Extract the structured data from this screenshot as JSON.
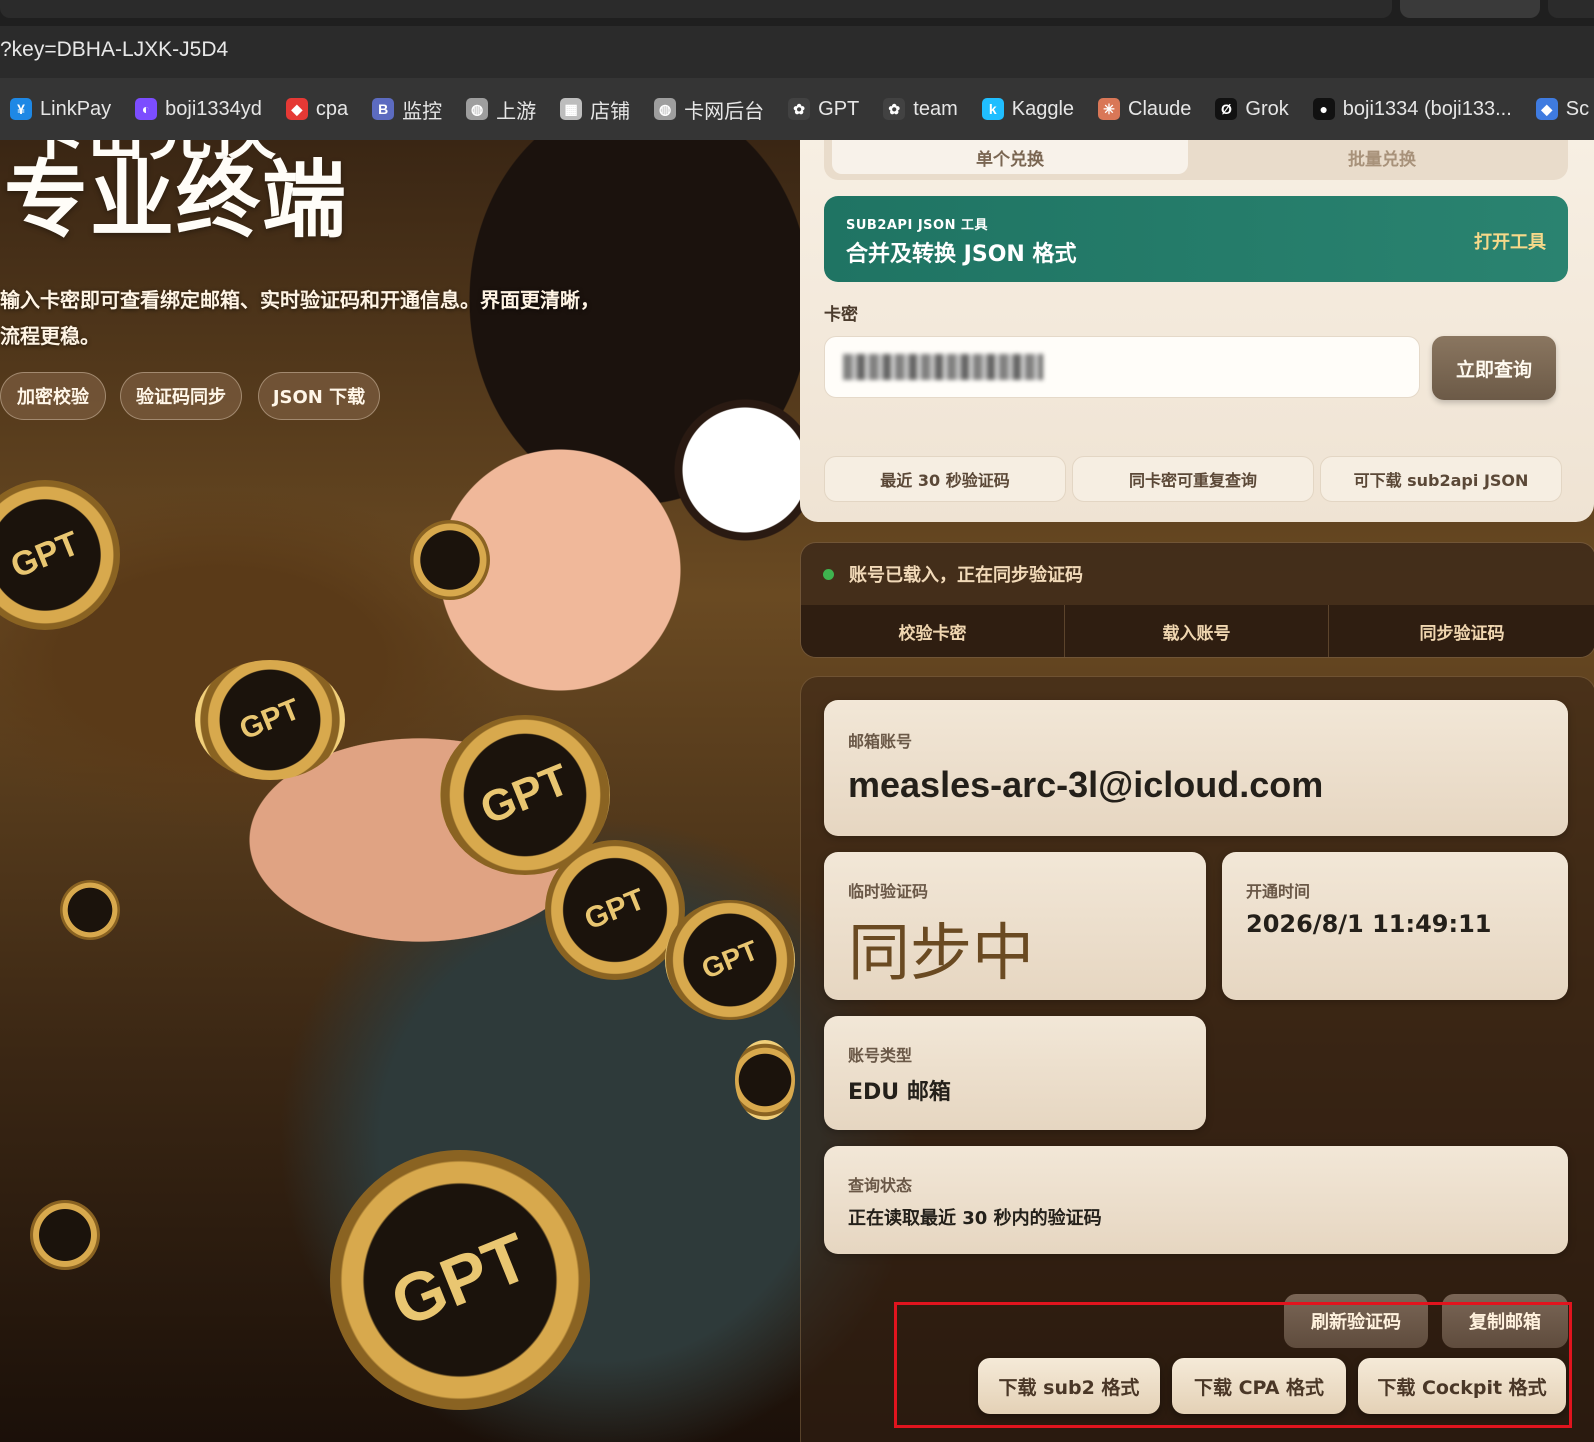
{
  "browser": {
    "address": "?key=DBHA-LJXK-J5D4",
    "bookmarks": [
      {
        "label": "LinkPay",
        "icon": "linkpay-icon",
        "color": "#1e88e5",
        "glyph": "¥"
      },
      {
        "label": "boji1334yd",
        "icon": "crescent-icon",
        "color": "#7c4dff",
        "glyph": "◐"
      },
      {
        "label": "cpa",
        "icon": "colorful-bird-icon",
        "color": "#e53935",
        "glyph": "◆"
      },
      {
        "label": "监控",
        "icon": "b-logo-icon",
        "color": "#5c6bc0",
        "glyph": "B"
      },
      {
        "label": "上游",
        "icon": "globe-icon",
        "color": "#9e9e9e",
        "glyph": "◍"
      },
      {
        "label": "店铺",
        "icon": "shop-icon",
        "color": "#bdbdbd",
        "glyph": "▦"
      },
      {
        "label": "卡网后台",
        "icon": "globe-icon",
        "color": "#9e9e9e",
        "glyph": "◍"
      },
      {
        "label": "GPT",
        "icon": "openai-icon",
        "color": "#424242",
        "glyph": "✿"
      },
      {
        "label": "team",
        "icon": "openai-icon",
        "color": "#424242",
        "glyph": "✿"
      },
      {
        "label": "Kaggle",
        "icon": "kaggle-icon",
        "color": "#20beff",
        "glyph": "k"
      },
      {
        "label": "Claude",
        "icon": "claude-icon",
        "color": "#d97757",
        "glyph": "✳"
      },
      {
        "label": "Grok",
        "icon": "grok-icon",
        "color": "#111111",
        "glyph": "Ø"
      },
      {
        "label": "boji1334 (boji133...",
        "icon": "github-icon",
        "color": "#111111",
        "glyph": "●"
      },
      {
        "label": "Sc",
        "icon": "diamond-icon",
        "color": "#3f7be0",
        "glyph": "◆"
      }
    ]
  },
  "hero": {
    "title_top": "卡密兑换",
    "title": "专业终端",
    "description": "输入卡密即可查看绑定邮箱、实时验证码和开通信息。界面更清晰，流程更稳。",
    "chips": [
      "加密校验",
      "验证码同步",
      "JSON 下载"
    ],
    "coin_text": "GPT"
  },
  "redeem": {
    "tabs": [
      "单个兑换",
      "批量兑换"
    ],
    "tool": {
      "eyebrow": "SUB2API JSON 工具",
      "title": "合并及转换 JSON 格式",
      "open_label": "打开工具"
    },
    "key_label": "卡密",
    "query_button": "立即查询",
    "features": [
      "最近 30 秒验证码",
      "同卡密可重复查询",
      "可下载 sub2api JSON"
    ]
  },
  "status": {
    "message": "账号已载入，正在同步验证码",
    "dot_color": "#3fb34f",
    "steps": [
      "校验卡密",
      "载入账号",
      "同步验证码"
    ]
  },
  "result": {
    "email_label": "邮箱账号",
    "email": "measles-arc-3l@icloud.com",
    "code_label": "临时验证码",
    "code": "同步中",
    "opened_label": "开通时间",
    "opened": "2026/8/1 11:49:11",
    "type_label": "账号类型",
    "type": "EDU 邮箱",
    "query_status_label": "查询状态",
    "query_status": "正在读取最近 30 秒内的验证码"
  },
  "actions": {
    "refresh": "刷新验证码",
    "copy_email": "复制邮箱",
    "download_sub2": "下载 sub2 格式",
    "download_cpa": "下载 CPA 格式",
    "download_cockpit": "下载 Cockpit 格式"
  }
}
